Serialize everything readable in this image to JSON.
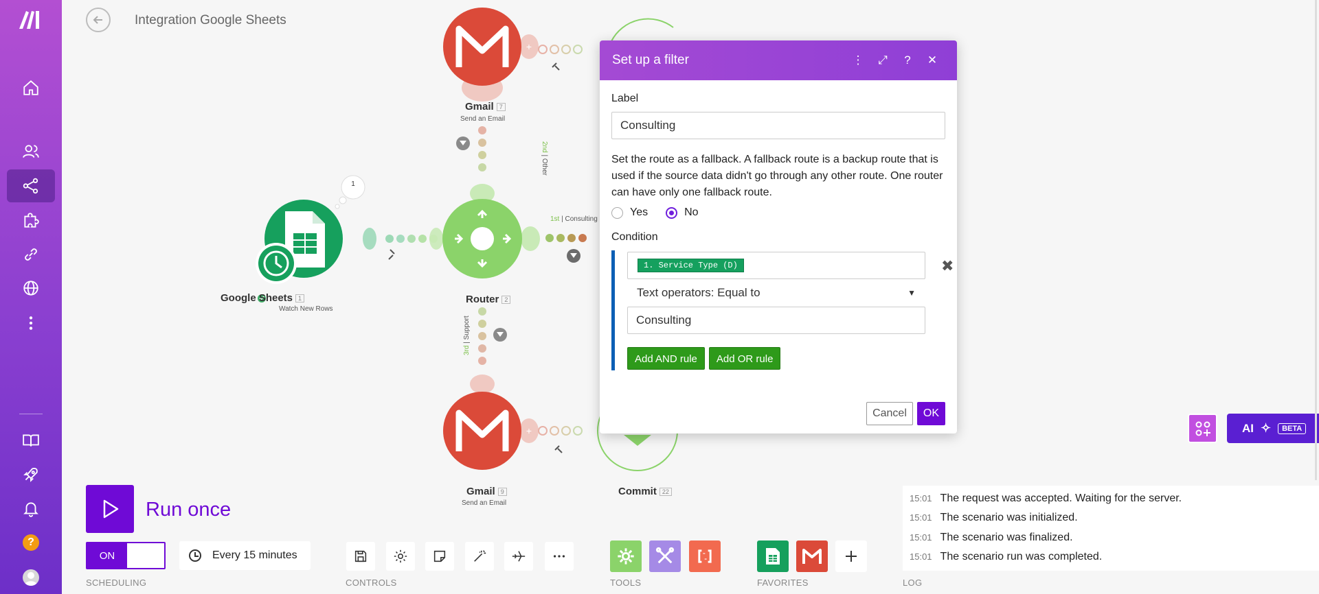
{
  "header": {
    "title": "Integration Google Sheets"
  },
  "sidebar": {
    "items": [
      "home",
      "team",
      "scenarios",
      "apps",
      "connections",
      "webhooks",
      "more"
    ],
    "bottom": [
      "docs",
      "whats-new",
      "notifications",
      "help",
      "profile"
    ],
    "help_label": "?"
  },
  "canvas": {
    "modules": {
      "sheets": {
        "label": "Google Sheets",
        "id": "1",
        "sub": "Watch New Rows",
        "bubble": "1"
      },
      "router": {
        "label": "Router",
        "id": "2"
      },
      "gmail_top": {
        "label": "Gmail",
        "id": "7",
        "sub": "Send an Email"
      },
      "gmail_bottom": {
        "label": "Gmail",
        "id": "9",
        "sub": "Send an Email"
      },
      "commit": {
        "label": "Commit",
        "id": "22"
      }
    },
    "routes": {
      "r1": {
        "order": "1st",
        "name": "Consulting"
      },
      "r2": {
        "order": "2nd",
        "name": "Other"
      },
      "r3": {
        "order": "3rd",
        "name": "Support"
      }
    }
  },
  "dialog": {
    "title": "Set up a filter",
    "label_heading": "Label",
    "label_value": "Consulting",
    "fallback_text": "Set the route as a fallback. A fallback route is a backup route that is used if the source data didn't go through any other route. One router can have only one fallback route.",
    "yes": "Yes",
    "no": "No",
    "fallback_selected": "No",
    "condition_heading": "Condition",
    "condition_pill": "1. Service Type (D)",
    "operator": "Text operators: Equal to",
    "condition_value": "Consulting",
    "add_and": "Add AND rule",
    "add_or": "Add OR rule",
    "cancel": "Cancel",
    "ok": "OK"
  },
  "toolbar": {
    "run_label": "Run once",
    "toggle_on": "ON",
    "schedule": "Every 15 minutes",
    "sections": {
      "scheduling": "SCHEDULING",
      "controls": "CONTROLS",
      "tools": "TOOLS",
      "favorites": "FAVORITES",
      "log": "LOG"
    }
  },
  "log": [
    {
      "time": "15:01",
      "text": "The request was accepted. Waiting for the server."
    },
    {
      "time": "15:01",
      "text": "The scenario was initialized."
    },
    {
      "time": "15:01",
      "text": "The scenario was finalized."
    },
    {
      "time": "15:01",
      "text": "The scenario run was completed."
    }
  ],
  "ai": {
    "label": "AI",
    "badge": "BETA"
  },
  "colors": {
    "brand": "#6f0ad6",
    "gmail": "#db4a39",
    "sheets": "#16a05d",
    "router": "#8bd36a",
    "green_button": "#2e9a1a"
  }
}
